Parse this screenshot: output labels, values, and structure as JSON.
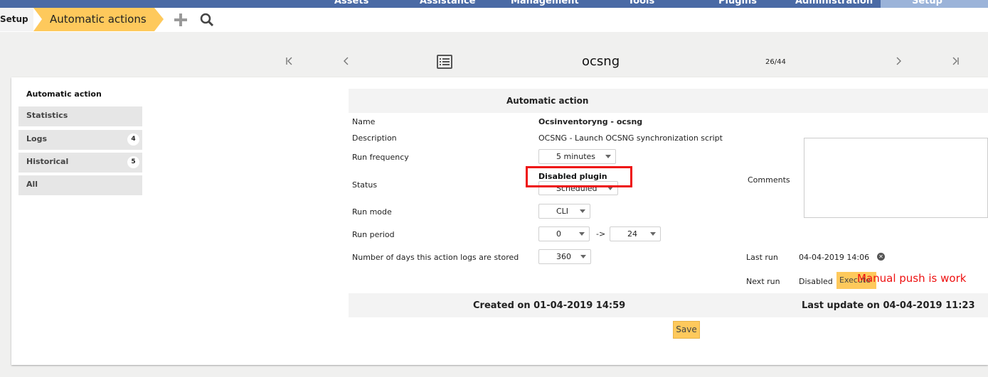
{
  "topnav": {
    "items": [
      "Assets",
      "Assistance",
      "Management",
      "Tools",
      "Plugins",
      "Administration"
    ],
    "active": "Setup"
  },
  "breadcrumb": {
    "root": "Setup",
    "current": "Automatic actions"
  },
  "record_nav": {
    "title": "ocsng",
    "count": "26/44"
  },
  "tabs": {
    "header": "Automatic action",
    "items": [
      {
        "label": "Statistics",
        "badge": ""
      },
      {
        "label": "Logs",
        "badge": "4"
      },
      {
        "label": "Historical",
        "badge": "5"
      },
      {
        "label": "All",
        "badge": ""
      }
    ]
  },
  "form": {
    "header": "Automatic action",
    "name_label": "Name",
    "name_value": "Ocsinventoryng - ocsng",
    "description_label": "Description",
    "description_value": "OCSNG - Launch OCSNG synchronization script",
    "run_frequency_label": "Run frequency",
    "run_frequency_value": "5 minutes",
    "status_label": "Status",
    "status_value": "Scheduled",
    "status_note": "Disabled plugin",
    "run_mode_label": "Run mode",
    "run_mode_value": "CLI",
    "run_period_label": "Run period",
    "run_period_from": "0",
    "run_period_arrow": "->",
    "run_period_to": "24",
    "log_days_label": "Number of days this action logs are stored",
    "log_days_value": "360",
    "comments_label": "Comments",
    "last_run_label": "Last run",
    "last_run_value": "04-04-2019 14:06",
    "next_run_label": "Next run",
    "next_run_value": "Disabled",
    "execute_label": "Execute",
    "annotation": "Manual push  is work",
    "created": "Created on 01-04-2019 14:59",
    "updated": "Last update on 04-04-2019 11:23",
    "save_label": "Save"
  },
  "colors": {
    "accent": "#fec95c",
    "nav": "#4a6aa5",
    "highlight": "#ee1111"
  }
}
